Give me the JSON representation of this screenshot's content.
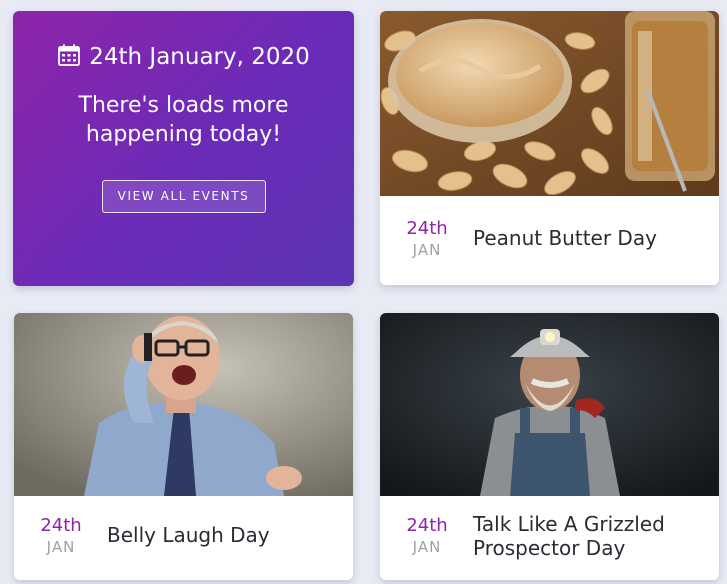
{
  "promo": {
    "date": "24th January, 2020",
    "subtitle": "There's loads more happening today!",
    "button_label": "VIEW ALL EVENTS",
    "icon": "calendar-icon"
  },
  "events": [
    {
      "day": "24th",
      "month": "JAN",
      "title": "Peanut Butter Day",
      "photo": "peanut-butter-photo"
    },
    {
      "day": "24th",
      "month": "JAN",
      "title": "Belly Laugh Day",
      "photo": "laughing-man-photo"
    },
    {
      "day": "24th",
      "month": "JAN",
      "title": "Talk Like A Grizzled Prospector Day",
      "photo": "prospector-photo"
    }
  ],
  "colors": {
    "accent": "#8e24aa",
    "gradient_end": "#5c35b4",
    "background": "#e8eaf4"
  }
}
